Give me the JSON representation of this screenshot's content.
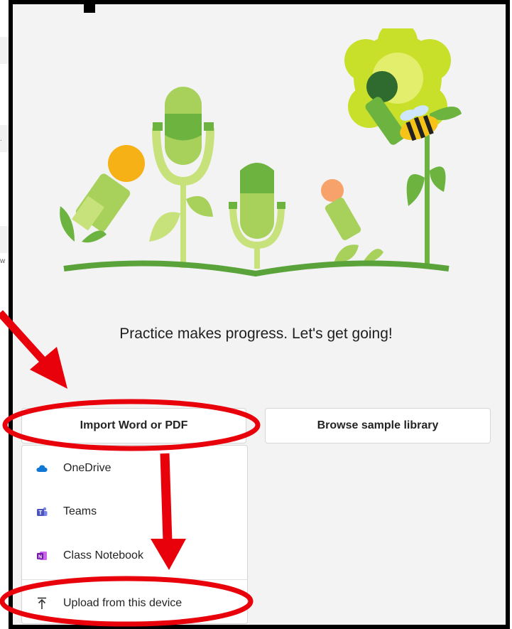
{
  "background_fragments": [
    ".",
    "w"
  ],
  "tagline": "Practice makes progress. Let's get going!",
  "buttons": {
    "import": "Import Word or PDF",
    "browse": "Browse sample library"
  },
  "import_menu": {
    "items": [
      {
        "label": "OneDrive",
        "icon": "onedrive-icon"
      },
      {
        "label": "Teams",
        "icon": "teams-icon"
      },
      {
        "label": "Class Notebook",
        "icon": "onenote-icon"
      },
      {
        "label": "Upload from this device",
        "icon": "upload-arrow-icon"
      }
    ]
  },
  "colors": {
    "annotation_red": "#e8000b",
    "leaf_green": "#6cb33f",
    "light_green": "#c7e27a",
    "flower_yellow": "#c9e02a"
  }
}
